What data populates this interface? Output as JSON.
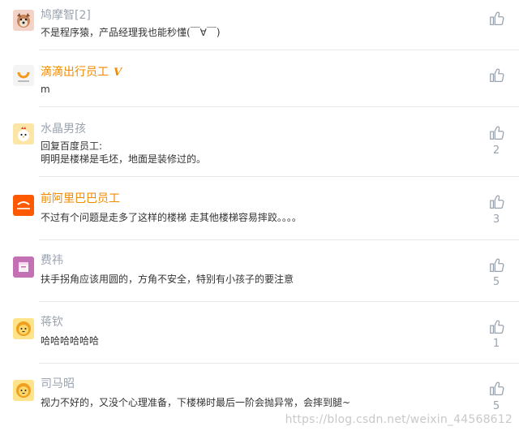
{
  "comments": [
    {
      "name": "鸠摩智[2]",
      "name_style": "gray",
      "verified": "",
      "content": [
        "不是程序猿，产品经理我也能秒懂(￣∀￣)"
      ],
      "likes": "",
      "avatar": "dog-avatar-icon"
    },
    {
      "name": "滴滴出行员工",
      "name_style": "orange",
      "verified": "V",
      "content": [
        "m"
      ],
      "likes": "",
      "avatar": "didi-logo-avatar"
    },
    {
      "name": "水晶男孩",
      "name_style": "gray",
      "verified": "",
      "content": [
        "回复百度员工:",
        "明明是楼梯是毛坯，地面是装修过的。"
      ],
      "likes": "2",
      "avatar": "chicken-avatar-icon"
    },
    {
      "name": "前阿里巴巴员工",
      "name_style": "orange",
      "verified": "",
      "content": [
        "不过有个问题是走多了这样的楼梯 走其他楼梯容易摔跤。。。。"
      ],
      "likes": "3",
      "avatar": "alibaba-logo-avatar"
    },
    {
      "name": "费祎",
      "name_style": "gray",
      "verified": "",
      "content": [
        "扶手拐角应该用圆的，方角不安全，特别有小孩子的要注意"
      ],
      "likes": "5",
      "avatar": "box-avatar-icon"
    },
    {
      "name": "蒋钦",
      "name_style": "gray",
      "verified": "",
      "content": [
        "哈哈哈哈哈哈"
      ],
      "likes": "1",
      "avatar": "lion-avatar-icon"
    },
    {
      "name": "司马昭",
      "name_style": "gray",
      "verified": "",
      "content": [
        "视力不好的，又没个心理准备，下楼梯时最后一阶会抛异常，会摔到腿~"
      ],
      "likes": "5",
      "avatar": "lion-avatar-icon"
    }
  ],
  "watermark": "https://blog.csdn.net/weixin_44568612",
  "colors": {
    "name_gray": "#9aa3b0",
    "name_orange": "#f08a00",
    "divider": "#e8e8e8"
  }
}
